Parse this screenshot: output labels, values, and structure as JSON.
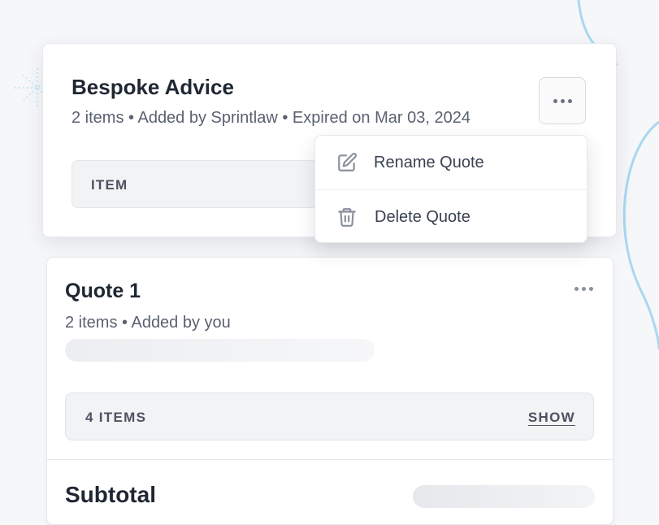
{
  "quote_card": {
    "title": "Bespoke Advice",
    "meta": "2 items • Added by Sprintlaw • Expired on Mar 03, 2024",
    "item_header": "ITEM"
  },
  "context_menu": {
    "items": [
      {
        "label": "Rename Quote",
        "icon": "edit-icon"
      },
      {
        "label": "Delete Quote",
        "icon": "trash-icon"
      }
    ]
  },
  "quote1_card": {
    "title": "Quote 1",
    "meta": "2 items • Added by you",
    "items_count_label": "4 ITEMS",
    "show_label": "SHOW",
    "subtotal_label": "Subtotal"
  },
  "colors": {
    "background": "#f6f7f9",
    "card": "#ffffff",
    "accent_line": "#a9d8f0",
    "text_primary": "#1f2733",
    "text_secondary": "#5a6170"
  }
}
